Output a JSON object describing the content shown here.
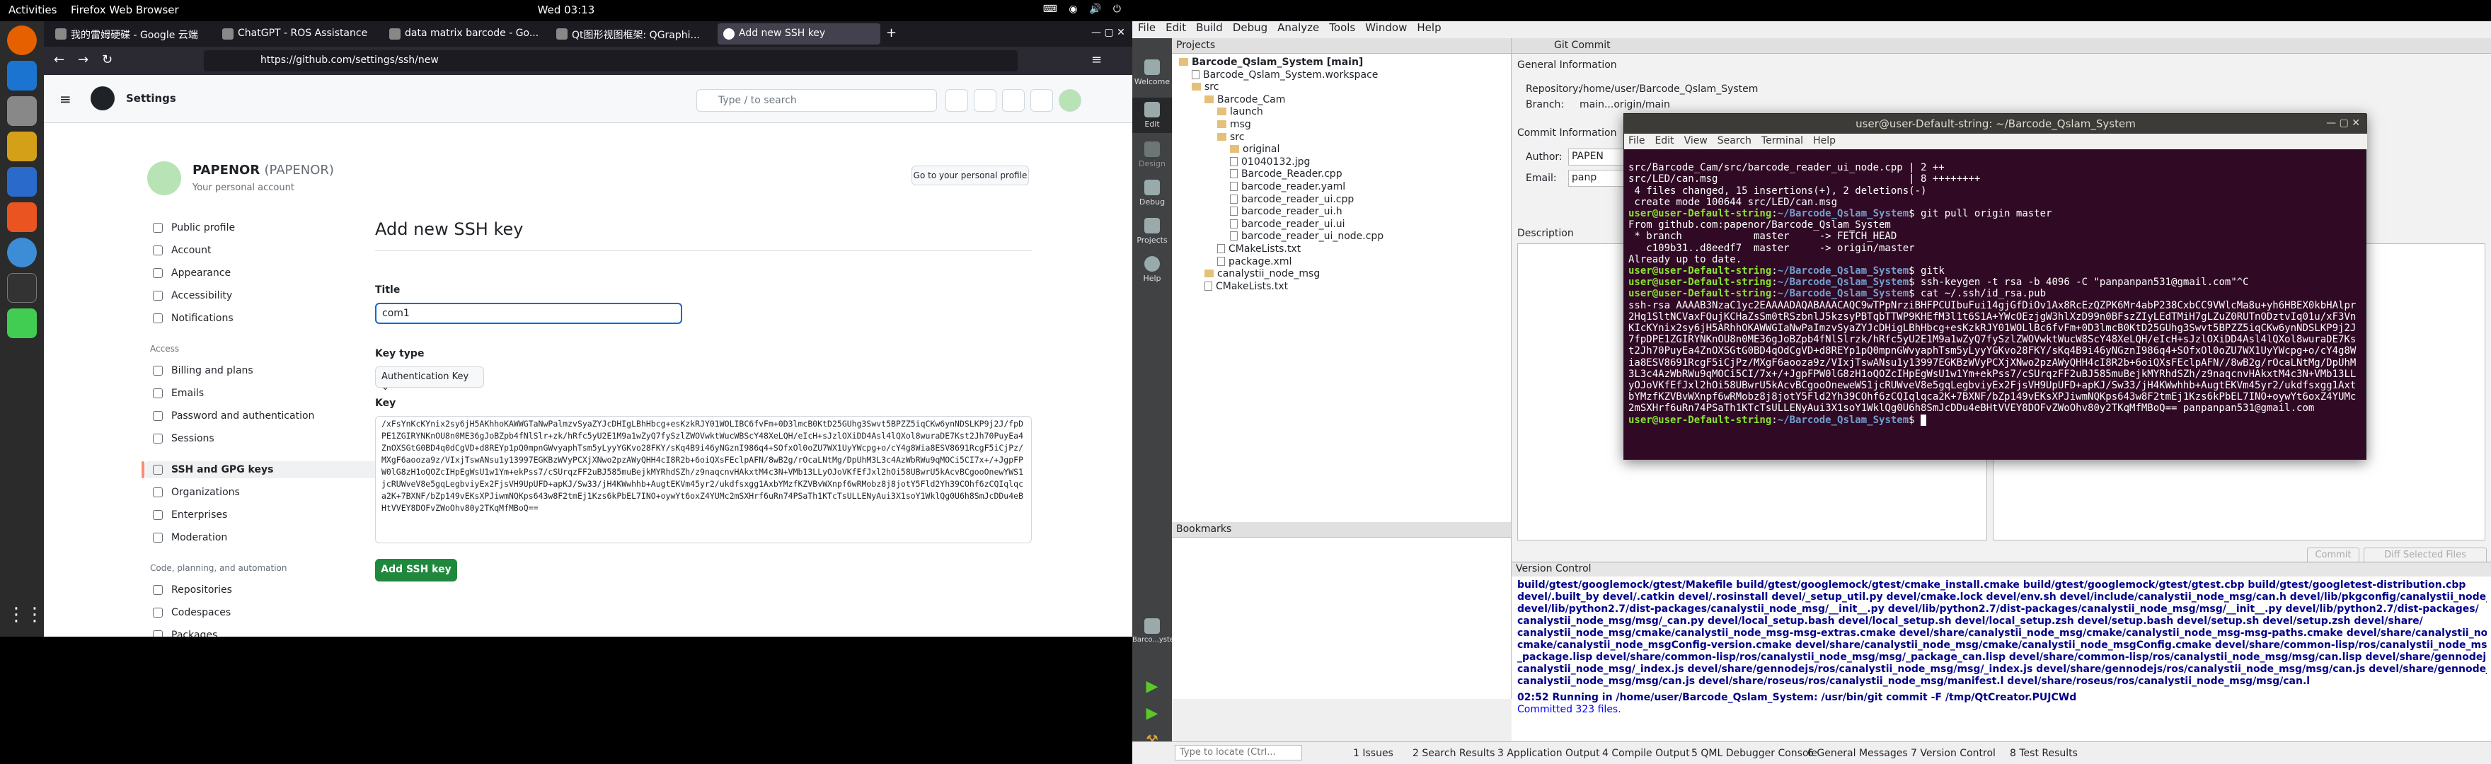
{
  "topbar": {
    "activities": "Activities",
    "app": "Firefox Web Browser",
    "clock": "Wed 03:13"
  },
  "firefox": {
    "tabs": [
      "我的雷姆硬碟 - Google 云端",
      "ChatGPT - ROS Assistance",
      "data matrix barcode - Go...",
      "Qt图形视图框架: QGraphi...",
      "Add new SSH key"
    ],
    "url": "https://github.com/settings/ssh/new"
  },
  "github": {
    "header_title": "Settings",
    "search_placeholder": "Type / to search",
    "user_name": "PAPENOR",
    "user_handle": "(PAPENOR)",
    "user_sub": "Your personal account",
    "go_profile": "Go to your personal profile",
    "sidebar": [
      "Public profile",
      "Account",
      "Appearance",
      "Accessibility",
      "Notifications"
    ],
    "access_header": "Access",
    "access": [
      "Billing and plans",
      "Emails",
      "Password and authentication",
      "Sessions",
      "SSH and GPG keys",
      "Organizations",
      "Enterprises",
      "Moderation"
    ],
    "code_header": "Code, planning, and automation",
    "code": [
      "Repositories",
      "Codespaces",
      "Packages",
      "Copilot"
    ],
    "page_title": "Add new SSH key",
    "title_label": "Title",
    "title_value": "com1",
    "type_label": "Key type",
    "type_value": "Authentication Key",
    "key_label": "Key",
    "key_value": "/xFsYnKcKYnix2sy6jH5AKhhoKAWWGTaNwPalmzvSyaZYJcDHIgLBhHbcg+esKzkRJY01WOLIBC6fvFm+0D3lmcB0KtD25GUhg3Swvt5BPZZ5iqCKw6ynNDSLKP9j2J/fpDPE1ZGIRYNKnOU8n0ME36gJoBZpb4fNlSlr+zk/hRfc5yU2E1M9a1wZyQ7fySzlZWOVwktWucWBScY48XeLQH/eIcH+sJzlOXiDD4Asl4lQXol8wuraDE7Kst2Jh70PuyEa4ZnOXSGtG0BD4q0dCgVD+d8REYp1pQ0mpnGWvyaphTsm5yLyyYGKvo28FKY/sKq4B9i46yNGznI986q4+SOfxOl0oZU7WX1UyYWcpg+o/cY4g8Wia8ESV8691RcgF5iCjPz/MXgF6aooza9z/VIxjTswANsu1y13997EGKBzWVyPCXjXNwo2pzAWyQHH4cI8R2b+6oiQXsFEclpAFN/8wB2g/rOcaLNtMg/DpUhM3L3c4AzWbRWu9qMOCi5CI7x+/+JgpFPW0lG8zH1oQOZcIHpEgWsU1w1Ym+ekPss7/cSUrqzFF2uBJ585muBejkMYRhdSZh/z9naqcnvHAkxtM4c3N+VMb13LLyOJoVKfEfJxl2hOi58UBwrU5kAcvBCgooOnewYWS1jcRUWveV8e5gqLegbviyEx2FjsVH9UpUFD+apKJ/Sw33/jH4KWwhhb+AugtEKVm45yr2/ukdfsxgg1AxbYMzfKZVBvWXnpf6wRMobz8j8jotY5Fld2Yh39COhf6zCQIqlqca2K+7BXNF/bZp149vEKsXPJiwmNQKps643w8F2tmEj1Kzs6kPbEL7INO+oywYt6oxZ4YUMc2mSXHrf6uRn74PSaTh1KTcTsULLENyAui3X1soY1WklQg0U6h8SmJcDDu4eBHtVVEY8DOFvZWoOhv80y2TKqMfMBoQ==",
    "add_button": "Add SSH key"
  },
  "qt": {
    "menu": [
      "File",
      "Edit",
      "Build",
      "Debug",
      "Analyze",
      "Tools",
      "Window",
      "Help"
    ],
    "projects_header": "Projects",
    "commit_tab": "Git Commit",
    "modes": [
      "Welcome",
      "Edit",
      "Design",
      "Debug",
      "Projects",
      "Help"
    ],
    "tree": [
      {
        "d": 0,
        "t": "Barcode_Qslam_System [main]",
        "k": "p"
      },
      {
        "d": 1,
        "t": "Barcode_Qslam_System.workspace",
        "k": "f"
      },
      {
        "d": 1,
        "t": "src",
        "k": "d"
      },
      {
        "d": 2,
        "t": "Barcode_Cam",
        "k": "d"
      },
      {
        "d": 3,
        "t": "launch",
        "k": "d"
      },
      {
        "d": 3,
        "t": "msg",
        "k": "d"
      },
      {
        "d": 3,
        "t": "src",
        "k": "d"
      },
      {
        "d": 4,
        "t": "original",
        "k": "d"
      },
      {
        "d": 4,
        "t": "01040132.jpg",
        "k": "f"
      },
      {
        "d": 4,
        "t": "Barcode_Reader.cpp",
        "k": "f"
      },
      {
        "d": 4,
        "t": "barcode_reader.yaml",
        "k": "f"
      },
      {
        "d": 4,
        "t": "barcode_reader_ui.cpp",
        "k": "f"
      },
      {
        "d": 4,
        "t": "barcode_reader_ui.h",
        "k": "f"
      },
      {
        "d": 4,
        "t": "barcode_reader_ui.ui",
        "k": "f"
      },
      {
        "d": 4,
        "t": "barcode_reader_ui_node.cpp",
        "k": "f"
      },
      {
        "d": 3,
        "t": "CMakeLists.txt",
        "k": "f"
      },
      {
        "d": 3,
        "t": "package.xml",
        "k": "f"
      },
      {
        "d": 2,
        "t": "canalystii_node_msg",
        "k": "d"
      },
      {
        "d": 2,
        "t": "CMakeLists.txt",
        "k": "f"
      }
    ],
    "bookmarks": "Bookmarks",
    "general_info": "General Information",
    "repository_label": "Repository:",
    "repository": "/home/user/Barcode_Qslam_System",
    "branch_label": "Branch:",
    "branch": "main...origin/main",
    "commit_info": "Commit Information",
    "author_label": "Author:",
    "author": "PAPEN",
    "email_label": "Email:",
    "email": "panp",
    "description": "Description",
    "commit_btn": "Commit",
    "diff_btn": "Diff Selected Files",
    "vc_header": "Version Control",
    "vc_lines": [
      "build/gtest/googlemock/gtest/Makefile build/gtest/googlemock/gtest/cmake_install.cmake build/gtest/googlemock/gtest/gtest.cbp build/gtest/googletest-distribution.cbp",
      "devel/.built_by devel/.catkin devel/.rosinstall devel/_setup_util.py devel/cmake.lock devel/env.sh devel/include/canalystii_node_msg/can.h devel/lib/pkgconfig/canalystii_node_msg.pc",
      "devel/lib/python2.7/dist-packages/canalystii_node_msg/__init__.py devel/lib/python2.7/dist-packages/canalystii_node_msg/msg/__init__.py devel/lib/python2.7/dist-packages/",
      "canalystii_node_msg/msg/_can.py devel/local_setup.bash devel/local_setup.sh devel/local_setup.zsh devel/setup.bash devel/setup.sh devel/setup.zsh devel/share/",
      "canalystii_node_msg/cmake/canalystii_node_msg-msg-extras.cmake devel/share/canalystii_node_msg/cmake/canalystii_node_msg-msg-paths.cmake devel/share/canalystii_node_msg/",
      "cmake/canalystii_node_msgConfig-version.cmake devel/share/canalystii_node_msg/cmake/canalystii_node_msgConfig.cmake devel/share/common-lisp/ros/canalystii_node_msg/msg/",
      "_package.lisp devel/share/common-lisp/ros/canalystii_node_msg/msg/_package_can.lisp devel/share/common-lisp/ros/canalystii_node_msg/msg/can.lisp devel/share/gennodejs/ros/",
      "canalystii_node_msg/_index.js devel/share/gennodejs/ros/canalystii_node_msg/msg/_index.js devel/share/gennodejs/ros/canalystii_node_msg/msg/can.js devel/share/gennodejs/ros/",
      "canalystii_node_msg/msg/can.js devel/share/roseus/ros/canalystii_node_msg/manifest.l devel/share/roseus/ros/canalystii_node_msg/msg/can.l"
    ],
    "vc_running": "02:52 Running in /home/user/Barcode_Qslam_System: /usr/bin/git commit -F /tmp/QtCreator.PUJCWd",
    "vc_done": "Committed 323 files.",
    "status": [
      "1 Issues",
      "2 Search Results",
      "3 Application Output",
      "4 Compile Output",
      "5 QML Debugger Console",
      "6 General Messages",
      "7 Version Control",
      "8 Test Results"
    ],
    "locate_placeholder": "Type to locate (Ctrl...",
    "target_label": "Barco...ystem"
  },
  "terminal": {
    "title": "user@user-Default-string: ~/Barcode_Qslam_System",
    "menu": [
      "File",
      "Edit",
      "View",
      "Search",
      "Terminal",
      "Help"
    ],
    "user": "user@user-Default-string",
    "path": "~/Barcode_Qslam_System",
    "pre": [
      "src/Barcode_Cam/src/barcode_reader_ui_node.cpp | 2 ++",
      "src/LED/can.msg                                | 8 ++++++++",
      " 4 files changed, 15 insertions(+), 2 deletions(-)",
      " create mode 100644 src/LED/can.msg"
    ],
    "cmd1": "git pull origin master",
    "pull": [
      "From github.com:papenor/Barcode_Qslam_System",
      " * branch            master     -> FETCH_HEAD",
      "   c109b31..d8eedf7  master     -> origin/master",
      "Already up to date."
    ],
    "cmd2": "gitk",
    "cmd3": "ssh-keygen -t rsa -b 4096 -C \"panpanpan531@gmail.com\"^C",
    "cmd4": "cat ~/.ssh/id_rsa.pub",
    "key": "ssh-rsa AAAAB3NzaC1yc2EAAAADAQABAAACAQC9wTPpNrziBHFPCUIbuFui14gjGfDiOv1Ax8RcEzQZPK6Mr4abP238CxbCC9VWlcMa8u+yh6HBEX0kbHAlpr2Hq1SltNCVaxFQujKCHaZsSm0tRSzbnlJ5kzsyPBTqbTTWP9KHEfM3l1t6S1A+YWcOEzjgW3hlXzD99n0BFszZIyLEdTMiH7gLZuZ0RUTnODztvIq01u/xF3VnKIcKYnix2sy6jH5ARhhOKAWWGIaNwPaImzvSyaZYJcDHigLBhHbcg+esKzkRJY01WOLlBc6fvFm+0D3lmcB0KtD25GUhg3Swvt5BPZZ5iqCKw6ynNDSLKP9j2J7fpDPE1ZGIRYNKnOU8n0ME36gJoBZpb4fNlSlrzk/hRfc5yU2E1M9a1wZyQ7fySzlZWOVwktWucW8ScY48XeLQH/eIcH+sJzlOXiDD4Asl4lQXol8wuraDE7Kst2Jh70PuyEa4ZnOXSGtG0BD4qOdCgVD+d8REYp1pQ0mpnGWvyaphTsm5yLyyYGKvo28FKY/sKq4B9i46yNGznI986q4+SOfxOl0oZU7WX1UyYWcpg+o/cY4g8Wia8ESV8691RcgF5iCjPz/MXgF6aooza9z/VIxjTswANsu1y13997EGKBzWVyPCXjXNwo2pzAWyQHH4cI8R2b+6oiQXsFEclpAFN//8wB2g/rOcaLNtMg/DpUhM3L3c4AzWbRWu9qMOCi5CI/7x+/+JgpFPW0lG8zH1oQOZcIHpEgWsU1w1Ym+ekPss7/cSUrqzFF2uBJ585muBejkMYRhdSZh/z9naqcnvHAkxtM4c3N+VMb13LLyOJoVKfEfJxl2hOi58UBwrU5kAcvBCgooOneweWS1jcRUWveV8e5gqLegbviyEx2FjsVH9UpUFD+apKJ/Sw33/jH4KWwhhb+AugtEKVm45yr2/ukdfsxgg1AxtbYMzfKZVBvWXnpf6wRMobz8j8jotY5Fld2Yh39COhf6zCQIqlqca2K+7BXNF/bZp149vEKsXPJiwmNQKps643w8F2tmEj1Kzs6kPbEL7INO+oywYt6oxZ4YUMc2mSXHrf6uRn74PSaTh1KTcTsULLENyAui3X1soY1WklQg0U6h8SmJcDDu4eBHtVVEY8DOFvZWoOhv80y2TKqMfMBoQ== panpanpan531@gmail.com"
  }
}
